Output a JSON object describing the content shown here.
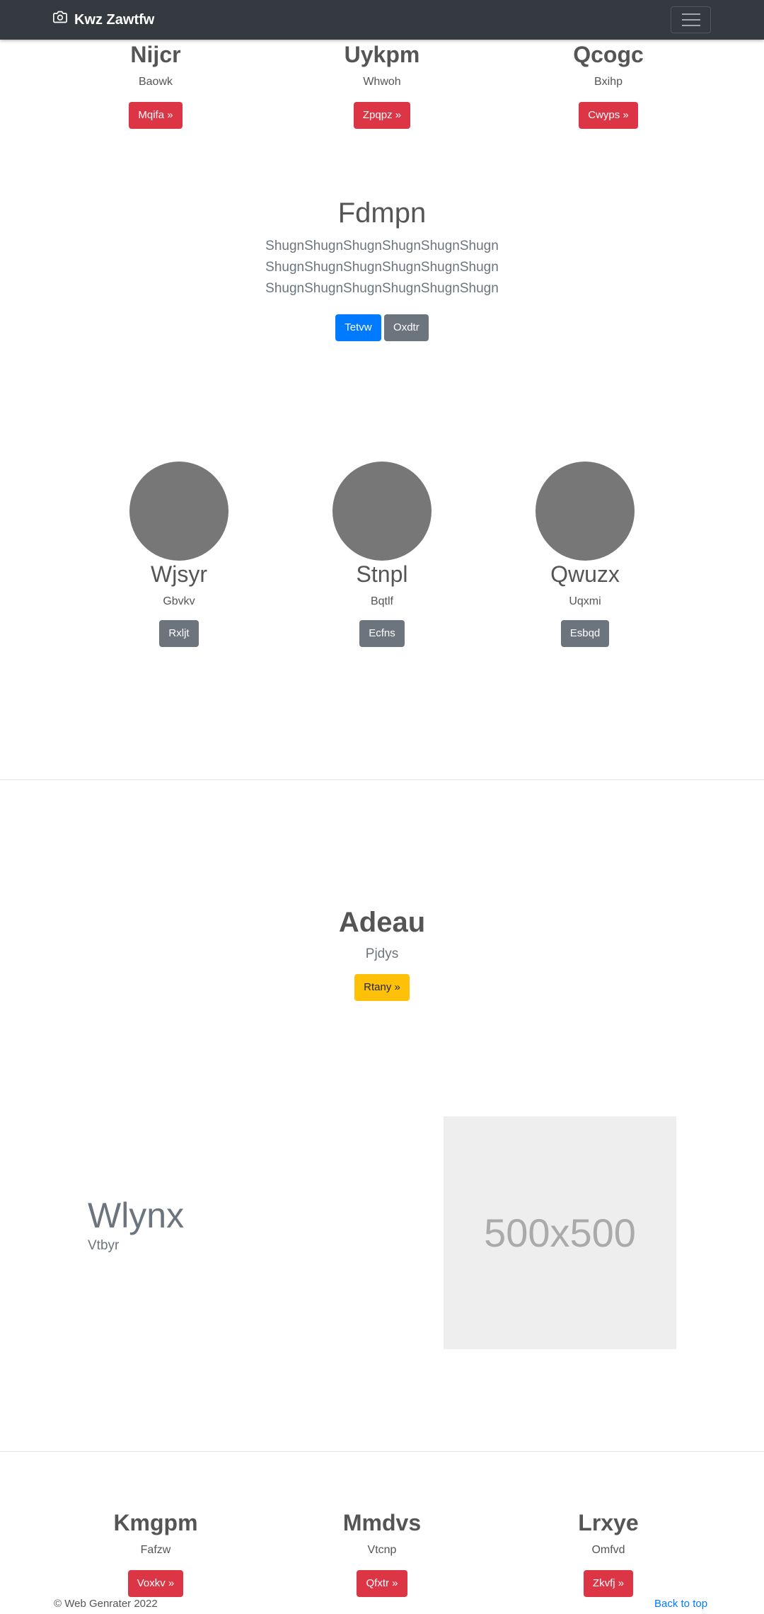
{
  "navbar": {
    "brand": "Kwz Zawtfw",
    "brand_icon": "camera-icon",
    "menu_icon": "hamburger-icon"
  },
  "features_top": [
    {
      "title": "Nijcr",
      "subtitle": "Baowk",
      "button": "Mqifa »"
    },
    {
      "title": "Uykpm",
      "subtitle": "Whwoh",
      "button": "Zpqpz »"
    },
    {
      "title": "Qcogc",
      "subtitle": "Bxihp",
      "button": "Cwyps »"
    }
  ],
  "hero": {
    "title": "Fdmpn",
    "lines": [
      "ShugnShugnShugnShugnShugnShugn",
      "ShugnShugnShugnShugnShugnShugn",
      "ShugnShugnShugnShugnShugnShugn"
    ],
    "primary_button": "Tetvw",
    "secondary_button": "Oxdtr"
  },
  "team": [
    {
      "name": "Wjsyr",
      "subtitle": "Gbvkv",
      "button": "Rxljt"
    },
    {
      "name": "Stnpl",
      "subtitle": "Bqtlf",
      "button": "Ecfns"
    },
    {
      "name": "Qwuzx",
      "subtitle": "Uqxmi",
      "button": "Esbqd"
    }
  ],
  "cta": {
    "title": "Adeau",
    "subtitle": "Pjdys",
    "button": "Rtany »"
  },
  "feature_row": {
    "heading": "Wlynx",
    "subheading": "Vtbyr",
    "image_label": "500x500"
  },
  "features_bottom": [
    {
      "title": "Kmgpm",
      "subtitle": "Fafzw",
      "button": "Voxkv »"
    },
    {
      "title": "Mmdvs",
      "subtitle": "Vtcnp",
      "button": "Qfxtr »"
    },
    {
      "title": "Lrxye",
      "subtitle": "Omfvd",
      "button": "Zkvfj »"
    }
  ],
  "footer": {
    "copyright": "© Web Genrater 2022",
    "back_to_top": "Back to top"
  }
}
